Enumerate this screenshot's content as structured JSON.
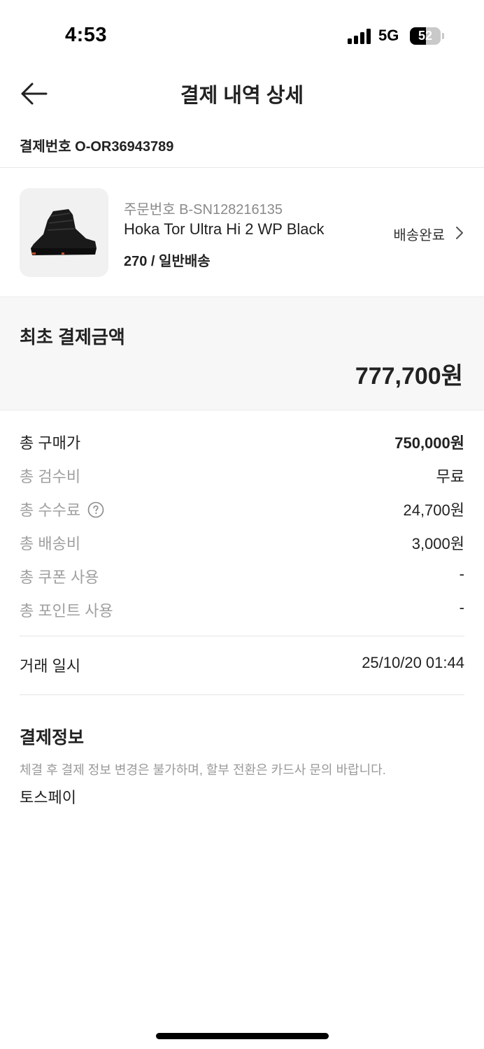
{
  "status_bar": {
    "time": "4:53",
    "network": "5G",
    "battery": "52",
    "battery_level": 0.52
  },
  "header": {
    "title": "결제 내역 상세",
    "back_icon": "arrow-left-icon"
  },
  "payment_number": "결제번호 O-OR36943789",
  "product": {
    "order_number": "주문번호 B-SN128216135",
    "name": "Hoka Tor Ultra Hi 2 WP Black",
    "option": "270 / 일반배송",
    "status": "배송완료",
    "status_icon": "chevron-right-icon",
    "image_icon": "boot-image"
  },
  "total": {
    "label": "최초 결제금액",
    "amount": "777,700원"
  },
  "breakdown": [
    {
      "label": "총 구매가",
      "value": "750,000원"
    },
    {
      "label": "총 검수비",
      "value": "무료"
    },
    {
      "label": "총 수수료",
      "value": "24,700원",
      "help_icon": "question-circle-icon"
    },
    {
      "label": "총 배송비",
      "value": "3,000원"
    },
    {
      "label": "총 쿠폰 사용",
      "value": "-"
    },
    {
      "label": "총 포인트 사용",
      "value": "-"
    }
  ],
  "deal": {
    "label": "거래 일시",
    "value": "25/10/20 01:44"
  },
  "payment_info": {
    "title": "결제정보",
    "note": "체결 후 결제 정보 변경은 불가하며, 할부 전환은 카드사 문의 바랍니다.",
    "method": "토스페이"
  },
  "colors": {
    "text_primary": "#222222",
    "text_secondary": "#a0a0a0",
    "panel_bg": "#f7f7f7",
    "divider": "#e8e8e8"
  }
}
